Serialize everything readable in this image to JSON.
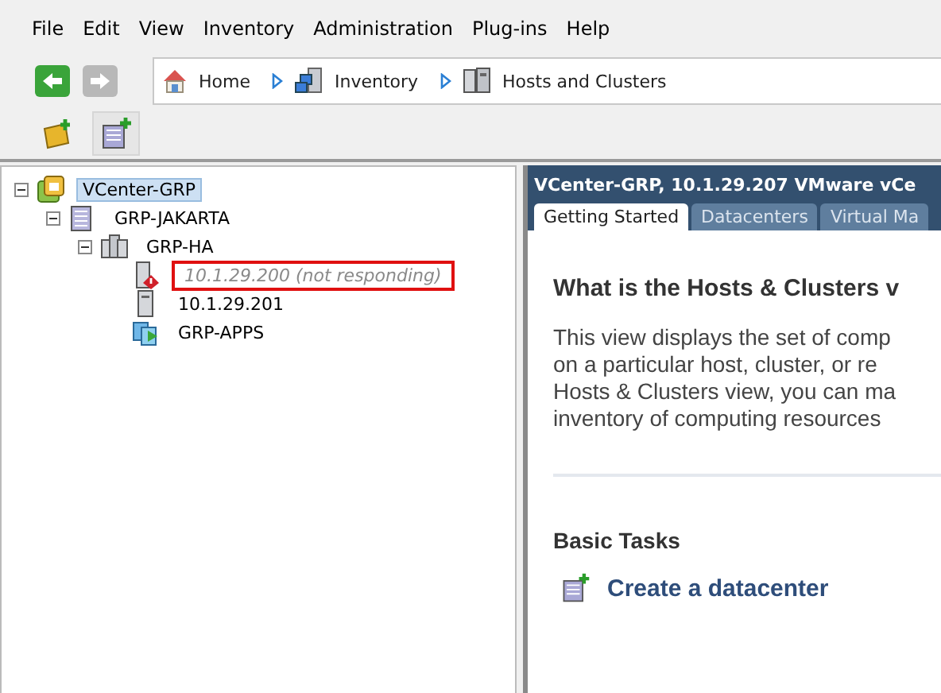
{
  "menu": [
    "File",
    "Edit",
    "View",
    "Inventory",
    "Administration",
    "Plug-ins",
    "Help"
  ],
  "nav": {
    "back_enabled": true,
    "forward_enabled": false,
    "breadcrumbs": [
      {
        "label": "Home",
        "kind": "home"
      },
      {
        "label": "Inventory",
        "kind": "inventory"
      },
      {
        "label": "Hosts and Clusters",
        "kind": "hosts"
      }
    ]
  },
  "toolbar": [
    {
      "kind": "folder",
      "pressed": false
    },
    {
      "kind": "datacenter",
      "pressed": true
    }
  ],
  "tree": [
    {
      "label": "VCenter-GRP",
      "kind": "vcenter",
      "selected": true,
      "expanded": true,
      "children": [
        {
          "label": "GRP-JAKARTA",
          "kind": "datacenter",
          "selected": false,
          "expanded": true,
          "children": [
            {
              "label": "GRP-HA",
              "kind": "cluster",
              "selected": false,
              "expanded": true,
              "children": [
                {
                  "label": "10.1.29.200 (not responding)",
                  "kind": "host",
                  "selected": false,
                  "responding": false,
                  "highlighted": true
                },
                {
                  "label": "10.1.29.201",
                  "kind": "host",
                  "selected": false,
                  "responding": true,
                  "highlighted": false
                },
                {
                  "label": "GRP-APPS",
                  "kind": "vapp",
                  "selected": false,
                  "highlighted": false
                }
              ]
            }
          ]
        }
      ]
    }
  ],
  "panel": {
    "title": "VCenter-GRP, 10.1.29.207 VMware vCe",
    "tabs": [
      {
        "label": "Getting Started",
        "selected": true
      },
      {
        "label": "Datacenters",
        "selected": false
      },
      {
        "label": "Virtual Ma",
        "selected": false
      }
    ],
    "heading": "What is the Hosts & Clusters v",
    "lines": [
      "This view displays the set of comp",
      "on a particular host, cluster, or re",
      "Hosts & Clusters view, you can ma",
      "inventory of computing resources"
    ],
    "tasks_heading": "Basic Tasks",
    "tasks": [
      {
        "label": "Create a datacenter",
        "kind": "datacenter"
      }
    ]
  }
}
